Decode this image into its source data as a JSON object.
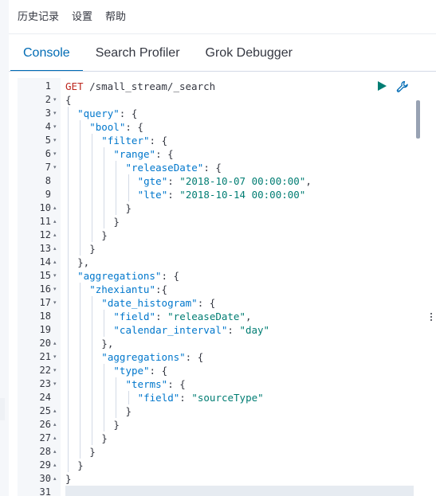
{
  "menu": {
    "items": [
      "历史记录",
      "设置",
      "帮助"
    ]
  },
  "tabs": [
    {
      "label": "Console",
      "active": true
    },
    {
      "label": "Search Profiler",
      "active": false
    },
    {
      "label": "Grok Debugger",
      "active": false
    }
  ],
  "editor": {
    "lines": [
      {
        "n": "1",
        "fold": "",
        "indent": 0,
        "tokens": [
          [
            "m",
            "GET"
          ],
          [
            "u",
            " /small_stream/_search"
          ]
        ]
      },
      {
        "n": "2",
        "fold": "▾",
        "indent": 0,
        "tokens": [
          [
            "p",
            "{"
          ]
        ]
      },
      {
        "n": "3",
        "fold": "▾",
        "indent": 1,
        "tokens": [
          [
            "k",
            "\"query\""
          ],
          [
            "p",
            ": {"
          ]
        ]
      },
      {
        "n": "4",
        "fold": "▾",
        "indent": 2,
        "tokens": [
          [
            "k",
            "\"bool\""
          ],
          [
            "p",
            ": {"
          ]
        ]
      },
      {
        "n": "5",
        "fold": "▾",
        "indent": 3,
        "tokens": [
          [
            "k",
            "\"filter\""
          ],
          [
            "p",
            ": {"
          ]
        ]
      },
      {
        "n": "6",
        "fold": "▾",
        "indent": 4,
        "tokens": [
          [
            "k",
            "\"range\""
          ],
          [
            "p",
            ": {"
          ]
        ]
      },
      {
        "n": "7",
        "fold": "▾",
        "indent": 5,
        "tokens": [
          [
            "k",
            "\"releaseDate\""
          ],
          [
            "p",
            ": {"
          ]
        ]
      },
      {
        "n": "8",
        "fold": "",
        "indent": 6,
        "tokens": [
          [
            "k",
            "\"gte\""
          ],
          [
            "p",
            ": "
          ],
          [
            "s",
            "\"2018-10-07 00:00:00\""
          ],
          [
            "p",
            ","
          ]
        ]
      },
      {
        "n": "9",
        "fold": "",
        "indent": 6,
        "tokens": [
          [
            "k",
            "\"lte\""
          ],
          [
            "p",
            ": "
          ],
          [
            "s",
            "\"2018-10-14 00:00:00\""
          ]
        ]
      },
      {
        "n": "10",
        "fold": "▴",
        "indent": 5,
        "tokens": [
          [
            "p",
            "}"
          ]
        ]
      },
      {
        "n": "11",
        "fold": "▴",
        "indent": 4,
        "tokens": [
          [
            "p",
            "}"
          ]
        ]
      },
      {
        "n": "12",
        "fold": "▴",
        "indent": 3,
        "tokens": [
          [
            "p",
            "}"
          ]
        ]
      },
      {
        "n": "13",
        "fold": "▴",
        "indent": 2,
        "tokens": [
          [
            "p",
            "}"
          ]
        ]
      },
      {
        "n": "14",
        "fold": "▴",
        "indent": 1,
        "tokens": [
          [
            "p",
            "},"
          ]
        ]
      },
      {
        "n": "15",
        "fold": "▾",
        "indent": 1,
        "tokens": [
          [
            "k",
            "\"aggregations\""
          ],
          [
            "p",
            ": {"
          ]
        ]
      },
      {
        "n": "16",
        "fold": "▾",
        "indent": 2,
        "tokens": [
          [
            "k",
            "\"zhexiantu\""
          ],
          [
            "p",
            ":{"
          ]
        ]
      },
      {
        "n": "17",
        "fold": "▾",
        "indent": 3,
        "tokens": [
          [
            "k",
            "\"date_histogram\""
          ],
          [
            "p",
            ": {"
          ]
        ]
      },
      {
        "n": "18",
        "fold": "",
        "indent": 4,
        "tokens": [
          [
            "k",
            "\"field\""
          ],
          [
            "p",
            ": "
          ],
          [
            "s",
            "\"releaseDate\""
          ],
          [
            "p",
            ","
          ]
        ]
      },
      {
        "n": "19",
        "fold": "",
        "indent": 4,
        "tokens": [
          [
            "k",
            "\"calendar_interval\""
          ],
          [
            "p",
            ": "
          ],
          [
            "s",
            "\"day\""
          ]
        ]
      },
      {
        "n": "20",
        "fold": "▴",
        "indent": 3,
        "tokens": [
          [
            "p",
            "},"
          ]
        ]
      },
      {
        "n": "21",
        "fold": "▾",
        "indent": 3,
        "tokens": [
          [
            "k",
            "\"aggregations\""
          ],
          [
            "p",
            ": {"
          ]
        ]
      },
      {
        "n": "22",
        "fold": "▾",
        "indent": 4,
        "tokens": [
          [
            "k",
            "\"type\""
          ],
          [
            "p",
            ": {"
          ]
        ]
      },
      {
        "n": "23",
        "fold": "▾",
        "indent": 5,
        "tokens": [
          [
            "k",
            "\"terms\""
          ],
          [
            "p",
            ": {"
          ]
        ]
      },
      {
        "n": "24",
        "fold": "",
        "indent": 6,
        "tokens": [
          [
            "k",
            "\"field\""
          ],
          [
            "p",
            ": "
          ],
          [
            "s",
            "\"sourceType\""
          ]
        ]
      },
      {
        "n": "25",
        "fold": "▴",
        "indent": 5,
        "tokens": [
          [
            "p",
            "}"
          ]
        ]
      },
      {
        "n": "26",
        "fold": "▴",
        "indent": 4,
        "tokens": [
          [
            "p",
            "}"
          ]
        ]
      },
      {
        "n": "27",
        "fold": "▴",
        "indent": 3,
        "tokens": [
          [
            "p",
            "}"
          ]
        ]
      },
      {
        "n": "28",
        "fold": "▴",
        "indent": 2,
        "tokens": [
          [
            "p",
            "}"
          ]
        ]
      },
      {
        "n": "29",
        "fold": "▴",
        "indent": 1,
        "tokens": [
          [
            "p",
            "}"
          ]
        ]
      },
      {
        "n": "30",
        "fold": "▴",
        "indent": 0,
        "tokens": [
          [
            "p",
            "}"
          ]
        ]
      },
      {
        "n": "31",
        "fold": "",
        "indent": 0,
        "tokens": []
      }
    ],
    "cursor_line": 31
  },
  "actions": {
    "send_icon": "play-icon",
    "settings_icon": "wrench-icon"
  },
  "colors": {
    "accent": "#006bb4",
    "method": "#bd271e",
    "key": "#0077cc",
    "string": "#017d73"
  }
}
